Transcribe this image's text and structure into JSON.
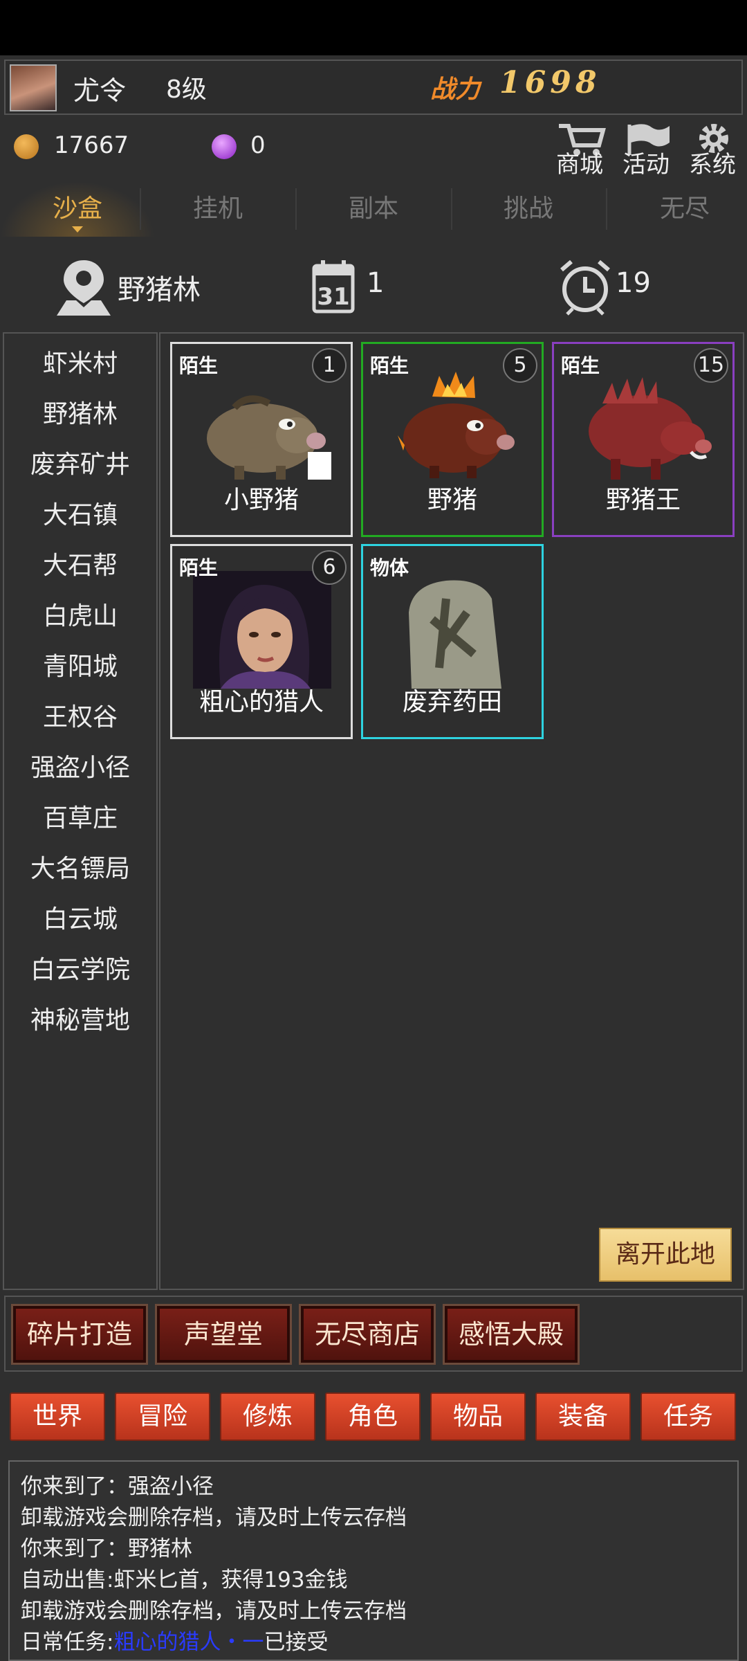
{
  "header": {
    "player_name": "尤令",
    "level": "8级",
    "power_label": "战力",
    "power_value": "1698"
  },
  "currency": {
    "gold": "17667",
    "gems": "0"
  },
  "top_menu": [
    {
      "label": "商城",
      "icon": "cart-icon"
    },
    {
      "label": "活动",
      "icon": "flag-icon"
    },
    {
      "label": "系统",
      "icon": "gear-icon"
    }
  ],
  "tabs": [
    "沙盒",
    "挂机",
    "副本",
    "挑战",
    "无尽"
  ],
  "info": {
    "location": "野猪林",
    "day": "1",
    "time": "19",
    "day_icon_text": "31"
  },
  "locations": [
    "虾米村",
    "野猪林",
    "废弃矿井",
    "大石镇",
    "大石帮",
    "白虎山",
    "青阳城",
    "王权谷",
    "强盗小径",
    "百草庄",
    "大名镖局",
    "白云城",
    "白云学院",
    "神秘营地"
  ],
  "cards": [
    {
      "tag": "陌生",
      "count": "1",
      "name": "小野猪",
      "border": "#dddddd"
    },
    {
      "tag": "陌生",
      "count": "5",
      "name": "野猪",
      "border": "#22aa22"
    },
    {
      "tag": "陌生",
      "count": "15",
      "name": "野猪王",
      "border": "#8a3fc0"
    },
    {
      "tag": "陌生",
      "count": "6",
      "name": "粗心的猎人",
      "border": "#dddddd"
    },
    {
      "tag": "物体",
      "name": "废弃药田",
      "border": "#2ed3e0"
    }
  ],
  "leave_button": "离开此地",
  "feature_buttons": [
    "碎片打造",
    "声望堂",
    "无尽商店",
    "感悟大殿"
  ],
  "bottom_nav": [
    "世界",
    "冒险",
    "修炼",
    "角色",
    "物品",
    "装备",
    "任务"
  ],
  "log": [
    "你来到了：强盗小径",
    "卸载游戏会删除存档，请及时上传云存档",
    "你来到了：野猪林",
    "自动出售:虾米匕首，获得193金钱",
    "卸载游戏会删除存档，请及时上传云存档"
  ],
  "log_quest": {
    "prefix": "日常任务:",
    "link": "粗心的猎人・一",
    "suffix": "已接受"
  },
  "colors": {
    "accent_gold": "#e7b04a",
    "link_blue": "#2a3bff",
    "button_red": "#d8432a"
  }
}
